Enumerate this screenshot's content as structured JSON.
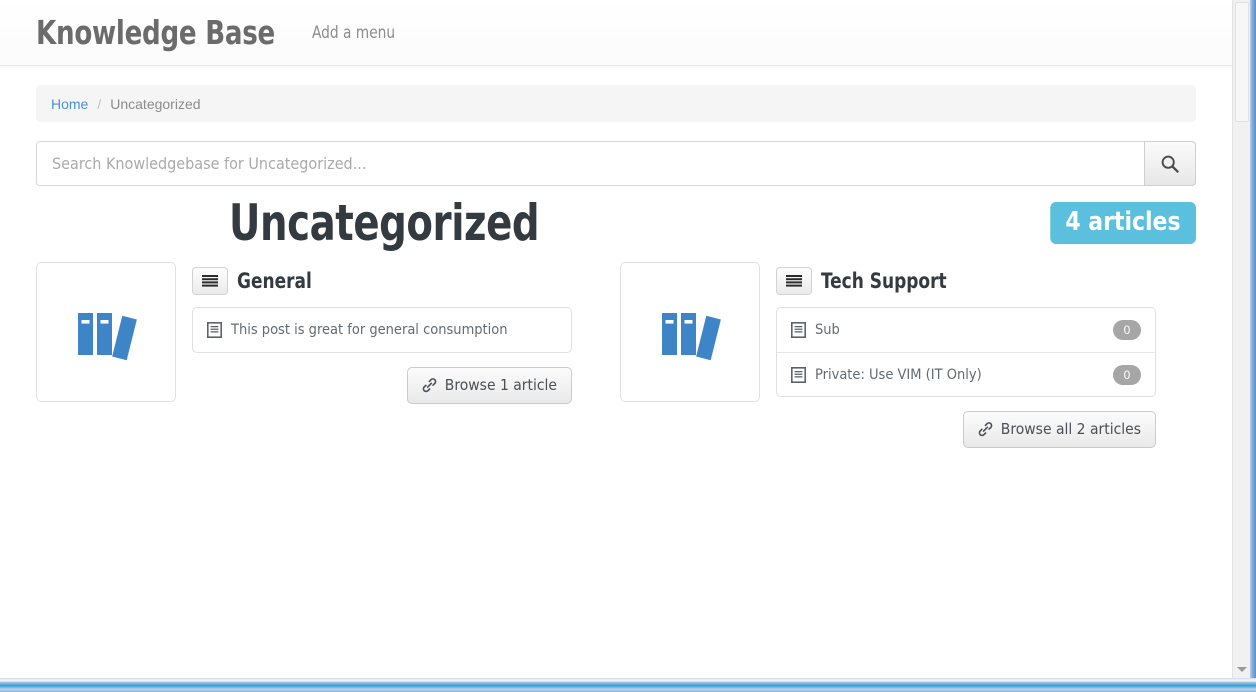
{
  "header": {
    "site_title": "Knowledge Base",
    "add_menu_label": "Add a menu"
  },
  "breadcrumb": {
    "home_label": "Home",
    "separator": "/",
    "current_label": "Uncategorized"
  },
  "search": {
    "placeholder": "Search Knowledgebase for Uncategorized...",
    "value": "",
    "button_icon": "search-icon"
  },
  "page": {
    "title": "Uncategorized",
    "badge_label": "4 articles",
    "badge_color": "#5bc0de"
  },
  "categories": [
    {
      "name": "General",
      "thumb_icon": "books-icon",
      "head_icon": "align-justify-icon",
      "articles": [
        {
          "title": "This post is great for general consumption",
          "icon": "file-text-icon",
          "count": null
        }
      ],
      "browse_label": "Browse 1 article",
      "browse_icon": "link-icon"
    },
    {
      "name": "Tech Support",
      "thumb_icon": "books-icon",
      "head_icon": "align-justify-icon",
      "articles": [
        {
          "title": "Sub",
          "icon": "file-text-icon",
          "count": "0"
        },
        {
          "title": "Private: Use VIM (IT Only)",
          "icon": "file-text-icon",
          "count": "0"
        }
      ],
      "browse_label": "Browse all 2 articles",
      "browse_icon": "link-icon"
    }
  ]
}
